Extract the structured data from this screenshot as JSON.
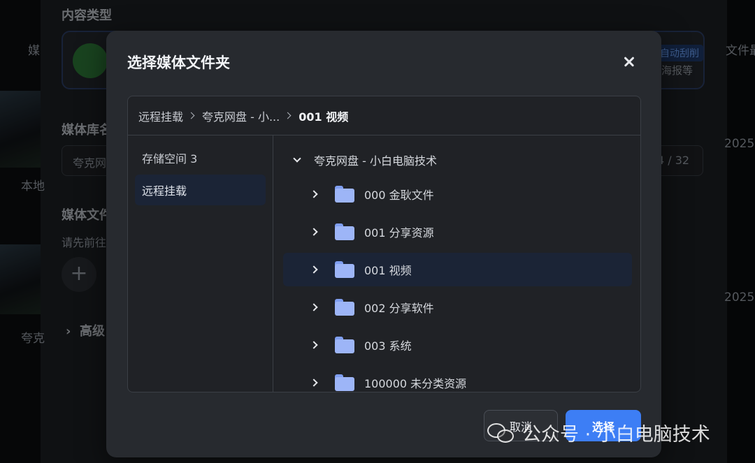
{
  "background": {
    "section_content_type": "内容类型",
    "media_partial": "媒",
    "badge_partial": "自动刮削",
    "card_desc_partial": "海报等",
    "right_col_partial": "文件最",
    "library_name_label_partial": "媒体库名",
    "library_name_value_partial": "夸克网",
    "counter_partial": "4 / 32",
    "media_folder_label_partial": "媒体文件",
    "media_folder_hint_partial": "请先前往",
    "advanced_partial": "高级",
    "left_label_1": "本地",
    "left_label_2": "夸克",
    "date_partial_1": "2025",
    "date_partial_2": "2025"
  },
  "dialog": {
    "title": "选择媒体文件夹",
    "breadcrumb": [
      "远程挂载",
      "夸克网盘 - 小...",
      "001 视频"
    ],
    "sidebar": [
      "存储空间 3",
      "远程挂载"
    ],
    "tree_root": "夸克网盘 - 小白电脑技术",
    "folders": [
      "000 金耿文件",
      "001 分享资源",
      "001 视频",
      "002 分享软件",
      "003 系统",
      "100000 未分类资源"
    ],
    "cancel_label": "取消",
    "select_label": "选择"
  },
  "watermark": {
    "text": "公众号 · 小白电脑技术"
  }
}
